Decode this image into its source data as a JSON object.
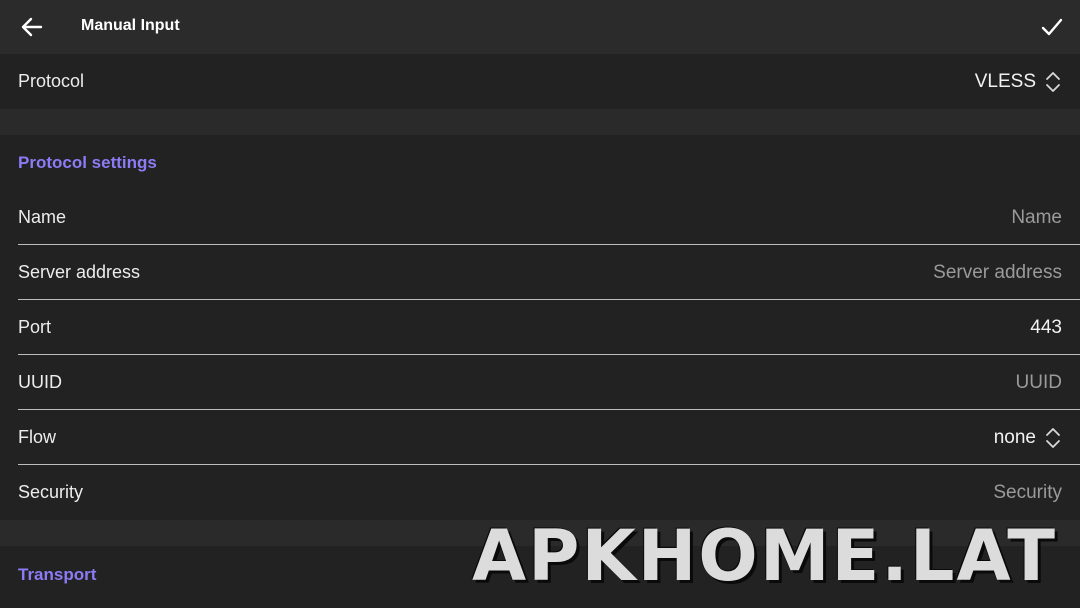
{
  "header": {
    "title": "Manual Input",
    "back_icon": "arrow-left-icon",
    "confirm_icon": "check-icon"
  },
  "protocol": {
    "label": "Protocol",
    "value": "VLESS"
  },
  "protocol_settings": {
    "title": "Protocol settings",
    "name": {
      "label": "Name",
      "placeholder": "Name"
    },
    "server_address": {
      "label": "Server address",
      "placeholder": "Server address"
    },
    "port": {
      "label": "Port",
      "value": "443"
    },
    "uuid": {
      "label": "UUID",
      "placeholder": "UUID"
    },
    "flow": {
      "label": "Flow",
      "value": "none"
    },
    "security": {
      "label": "Security",
      "placeholder": "Security"
    }
  },
  "transport": {
    "title": "Transport"
  },
  "watermark": "APKHOME.LAT",
  "colors": {
    "accent": "#8c7bf5",
    "background": "#1c1c1c",
    "toolbar": "#2b2b2b"
  }
}
